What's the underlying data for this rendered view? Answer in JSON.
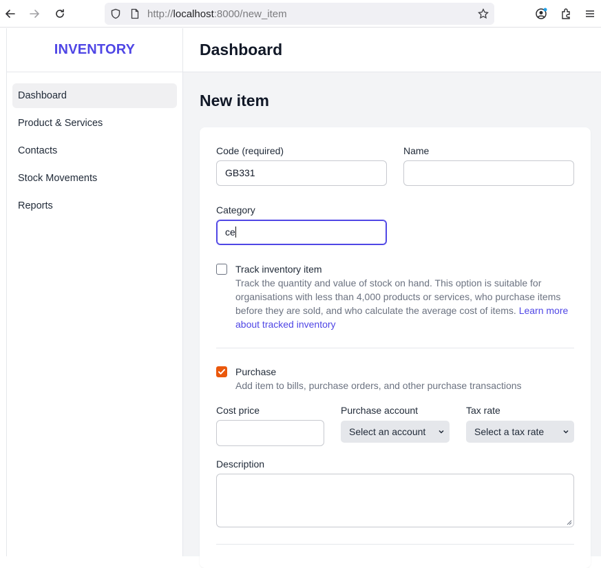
{
  "browser": {
    "url_scheme": "http://",
    "url_host": "localhost",
    "url_rest": ":8000/new_item"
  },
  "sidebar": {
    "brand": "INVENTORY",
    "items": [
      {
        "label": "Dashboard",
        "active": true
      },
      {
        "label": "Product & Services"
      },
      {
        "label": "Contacts"
      },
      {
        "label": "Stock Movements"
      },
      {
        "label": "Reports"
      }
    ]
  },
  "header": {
    "title": "Dashboard"
  },
  "page": {
    "title": "New item"
  },
  "form": {
    "code_label": "Code (required)",
    "code_value": "GB331",
    "name_label": "Name",
    "name_value": "",
    "category_label": "Category",
    "category_value": "ce",
    "track": {
      "title": "Track inventory item",
      "checked": false,
      "desc_line1": "Track the quantity and value of stock on hand. This option is suitable for",
      "desc_line2": "organisations with less than 4,000 products or services, who purchase items",
      "desc_line3_text": "before they are sold, and who calculate the average cost of items. ",
      "desc_line3_link": "Learn more",
      "desc_line4_link": "about tracked inventory"
    },
    "purchase": {
      "title": "Purchase",
      "checked": true,
      "desc": "Add item to bills, purchase orders, and other purchase transactions"
    },
    "cost_price_label": "Cost price",
    "cost_price_value": "",
    "purchase_account_label": "Purchase account",
    "purchase_account_selected": "Select an account",
    "tax_rate_label": "Tax rate",
    "tax_rate_selected": "Select a tax rate",
    "description_label": "Description",
    "description_value": ""
  },
  "colors": {
    "brand": "#4f46e5",
    "checkbox_checked": "#ea580c",
    "link": "#4f46e5"
  }
}
